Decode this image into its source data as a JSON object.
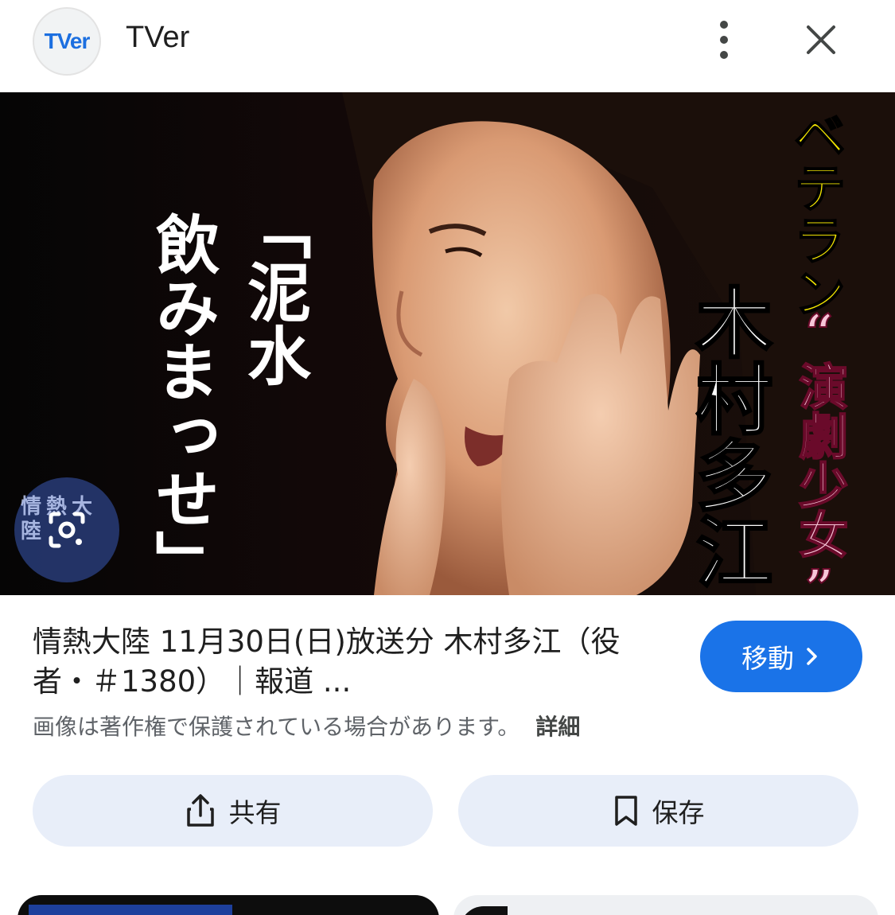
{
  "header": {
    "site_name": "TVer",
    "logo_text": "TVer",
    "more_icon": "more-vert-icon",
    "close_icon": "close-icon"
  },
  "hero": {
    "caption_quote": "「泥水飲みまっせ」",
    "caption_quote_line1": "「泥水",
    "caption_quote_line2": "飲みまっせ」",
    "caption_veteran": "ベテラン",
    "caption_role": "“演劇少女”",
    "caption_name": "木村多江",
    "watermark": "情熱大陸",
    "lens_icon": "google-lens-icon"
  },
  "result": {
    "title": "情熱大陸 11月30日(日)放送分 木村多江（役者・＃1380）｜報道 ...",
    "copyright": "画像は著作権で保護されている場合があります。",
    "detail_link": "詳細",
    "visit_label": "移動"
  },
  "actions": {
    "share_label": "共有",
    "save_label": "保存"
  },
  "colors": {
    "accent": "#1a73e8",
    "action_bg": "#e8eef9"
  }
}
